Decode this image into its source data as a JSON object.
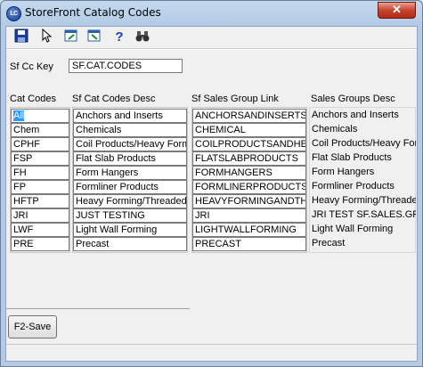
{
  "window": {
    "title": "StoreFront Catalog Codes",
    "app_icon_text": "LC",
    "close_glyph": "✕"
  },
  "toolbar": {
    "buttons": [
      {
        "icon": "save-icon",
        "glyph": "💾"
      },
      {
        "icon": "pointer-icon",
        "glyph": "↖"
      },
      {
        "icon": "export-icon",
        "glyph": "▣"
      },
      {
        "icon": "import-icon",
        "glyph": "▣"
      },
      {
        "icon": "help-icon",
        "glyph": "?"
      },
      {
        "icon": "binoculars-icon",
        "glyph": "⊗"
      }
    ]
  },
  "key": {
    "label": "Sf Cc Key",
    "value": "SF.CAT.CODES"
  },
  "columns": {
    "codes": "Cat Codes",
    "desc": "Sf Cat Codes Desc",
    "link": "Sf Sales Group Link",
    "sales_desc": "Sales Groups Desc"
  },
  "rows": [
    {
      "code": "All",
      "desc": "Anchors and Inserts",
      "link": "ANCHORSANDINSERTS",
      "sales_desc": "Anchors and Inserts"
    },
    {
      "code": "Chem",
      "desc": "Chemicals",
      "link": "CHEMICAL",
      "sales_desc": "Chemicals"
    },
    {
      "code": "CPHF",
      "desc": "Coil Products/Heavy Formi",
      "link": "COILPRODUCTSANDHEA",
      "sales_desc": "Coil Products/Heavy For"
    },
    {
      "code": "FSP",
      "desc": "Flat Slab Products",
      "link": "FLATSLABPRODUCTS",
      "sales_desc": "Flat Slab Products"
    },
    {
      "code": "FH",
      "desc": "Form Hangers",
      "link": "FORMHANGERS",
      "sales_desc": "Form Hangers"
    },
    {
      "code": "FP",
      "desc": "Formliner Products",
      "link": "FORMLINERPRODUCTS",
      "sales_desc": "Formliner Products"
    },
    {
      "code": "HFTP",
      "desc": "Heavy Forming/Threaded",
      "link": "HEAVYFORMINGANDTHE",
      "sales_desc": "Heavy Forming/Threade"
    },
    {
      "code": "JRI",
      "desc": "JUST TESTING",
      "link": "JRI",
      "sales_desc": "JRI TEST SF.SALES.GR"
    },
    {
      "code": "LWF",
      "desc": "Light Wall Forming",
      "link": "LIGHTWALLFORMING",
      "sales_desc": "Light Wall Forming"
    },
    {
      "code": "PRE",
      "desc": "Precast",
      "link": "PRECAST",
      "sales_desc": "Precast"
    }
  ],
  "save_button": {
    "label": "F2-Save"
  },
  "colors": {
    "selection": "#3399ff",
    "titlebar": "#b3cbe6",
    "close": "#c7422f"
  }
}
